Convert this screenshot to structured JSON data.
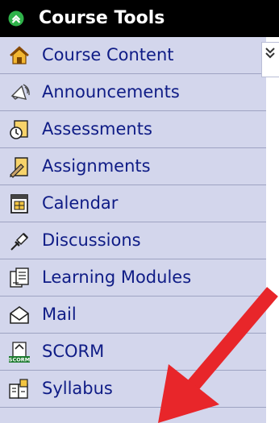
{
  "panel": {
    "title": "Course Tools",
    "items": [
      {
        "label": "Course Content",
        "icon": "course-content-icon"
      },
      {
        "label": "Announcements",
        "icon": "announcements-icon"
      },
      {
        "label": "Assessments",
        "icon": "assessments-icon"
      },
      {
        "label": "Assignments",
        "icon": "assignments-icon"
      },
      {
        "label": "Calendar",
        "icon": "calendar-icon"
      },
      {
        "label": "Discussions",
        "icon": "discussions-icon"
      },
      {
        "label": "Learning Modules",
        "icon": "learning-modules-icon"
      },
      {
        "label": "Mail",
        "icon": "mail-icon"
      },
      {
        "label": "SCORM",
        "icon": "scorm-icon"
      },
      {
        "label": "Syllabus",
        "icon": "syllabus-icon"
      }
    ],
    "scorm_icon_text": "SCORM"
  },
  "colors": {
    "panel_bg": "#d3d6ec",
    "header_bg": "#000000",
    "link_text": "#0f1c86",
    "arrow": "#e8262a"
  }
}
